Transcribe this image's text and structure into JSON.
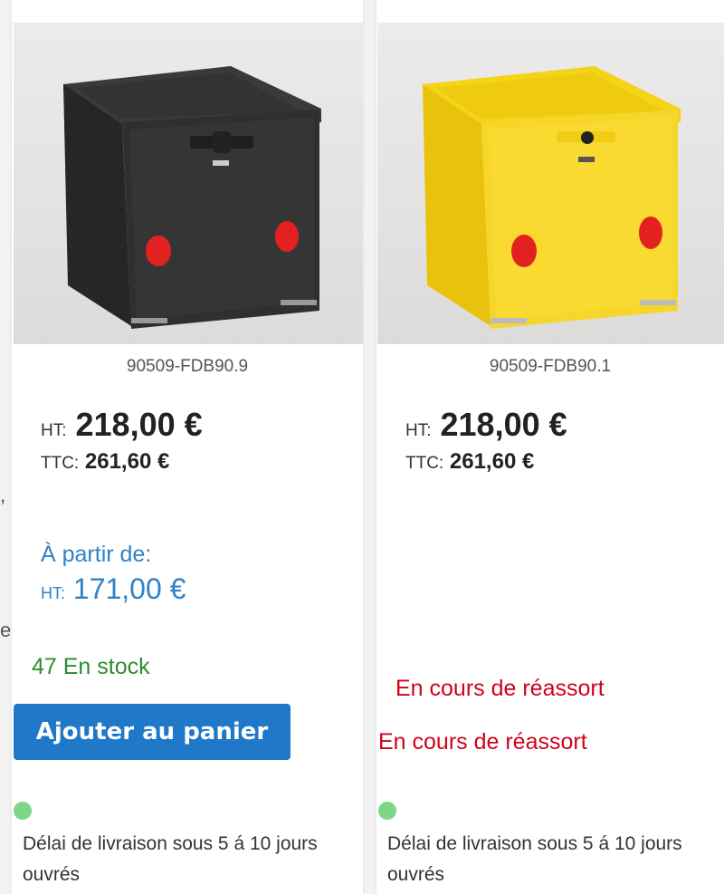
{
  "edge": {
    "comma": ",",
    "letter": "e"
  },
  "products": [
    {
      "sku": "90509-FDB90.9",
      "ht_label": "HT:",
      "ht_price": "218,00 €",
      "ttc_label": "TTC:",
      "ttc_price": "261,60 €",
      "from_label": "À partir de:",
      "from_ht_label": "HT:",
      "from_price": "171,00 €",
      "stock": "47 En stock",
      "add_button": "Ajouter au panier",
      "delivery": "Délai de livraison sous 5 á 10 jours ouvrés",
      "box_color": "#2c2c2c",
      "dot_color": "#7ed787"
    },
    {
      "sku": "90509-FDB90.1",
      "ht_label": "HT:",
      "ht_price": "218,00 €",
      "ttc_label": "TTC:",
      "ttc_price": "261,60 €",
      "restock_1": "En cours de réassort",
      "restock_2": "En cours de réassort",
      "delivery": "Délai de livraison sous 5 á 10 jours ouvrés",
      "box_color": "#f5d21a",
      "dot_color": "#7ed787"
    }
  ],
  "colors": {
    "accent_blue": "#1f78c8",
    "price_blue": "#2f82c8",
    "stock_green": "#2e8b2e",
    "restock_red": "#d0021b"
  }
}
